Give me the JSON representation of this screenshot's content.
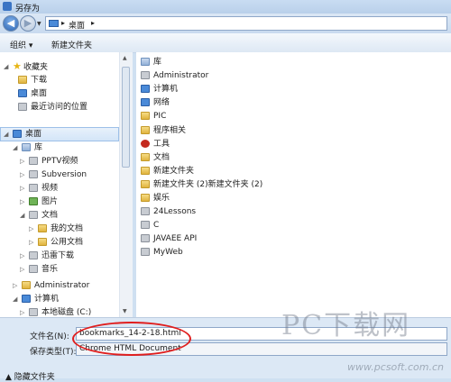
{
  "window": {
    "title": "另存为"
  },
  "address": {
    "location": "桌面"
  },
  "toolbar": {
    "organize_label": "组织 ▾",
    "new_folder_label": "新建文件夹"
  },
  "nav": {
    "favorites_label": "收藏夹",
    "favorites": [
      "下载",
      "桌面",
      "最近访问的位置"
    ],
    "selected": "桌面",
    "library_label": "库",
    "library_items": [
      "PPTV视频",
      "Subversion",
      "视频",
      "图片",
      "文档"
    ],
    "docs_children": [
      "我的文档",
      "公用文档"
    ],
    "after_docs": [
      "迅雷下载",
      "音乐"
    ],
    "admin": "Administrator",
    "computer": "计算机",
    "disk": "本地磁盘 (C:)"
  },
  "files": [
    "库",
    "Administrator",
    "计算机",
    "网络",
    "PIC",
    "程序相关",
    "工具",
    "文档",
    "新建文件夹",
    "新建文件夹 (2)新建文件夹 (2)",
    "娱乐",
    "24Lessons",
    "C",
    "JAVAEE API",
    "MyWeb"
  ],
  "file_icons": [
    "lib",
    "gray",
    "blue",
    "blue",
    "folder",
    "folder",
    "red",
    "folder",
    "folder",
    "folder",
    "folder",
    "gray",
    "gray",
    "gray",
    "gray"
  ],
  "bottom": {
    "filename_label": "文件名(N):",
    "filename_value": "bookmarks_14-2-18.html",
    "type_label": "保存类型(T):",
    "type_value": "Chrome HTML Document",
    "hide_folders": "隐藏文件夹"
  },
  "watermark": {
    "text": "PC下载网",
    "url": "www.pcsoft.com.cn"
  },
  "colors": {
    "highlight_ellipse": "#e01e1e",
    "selection": "#d3e5f8"
  }
}
